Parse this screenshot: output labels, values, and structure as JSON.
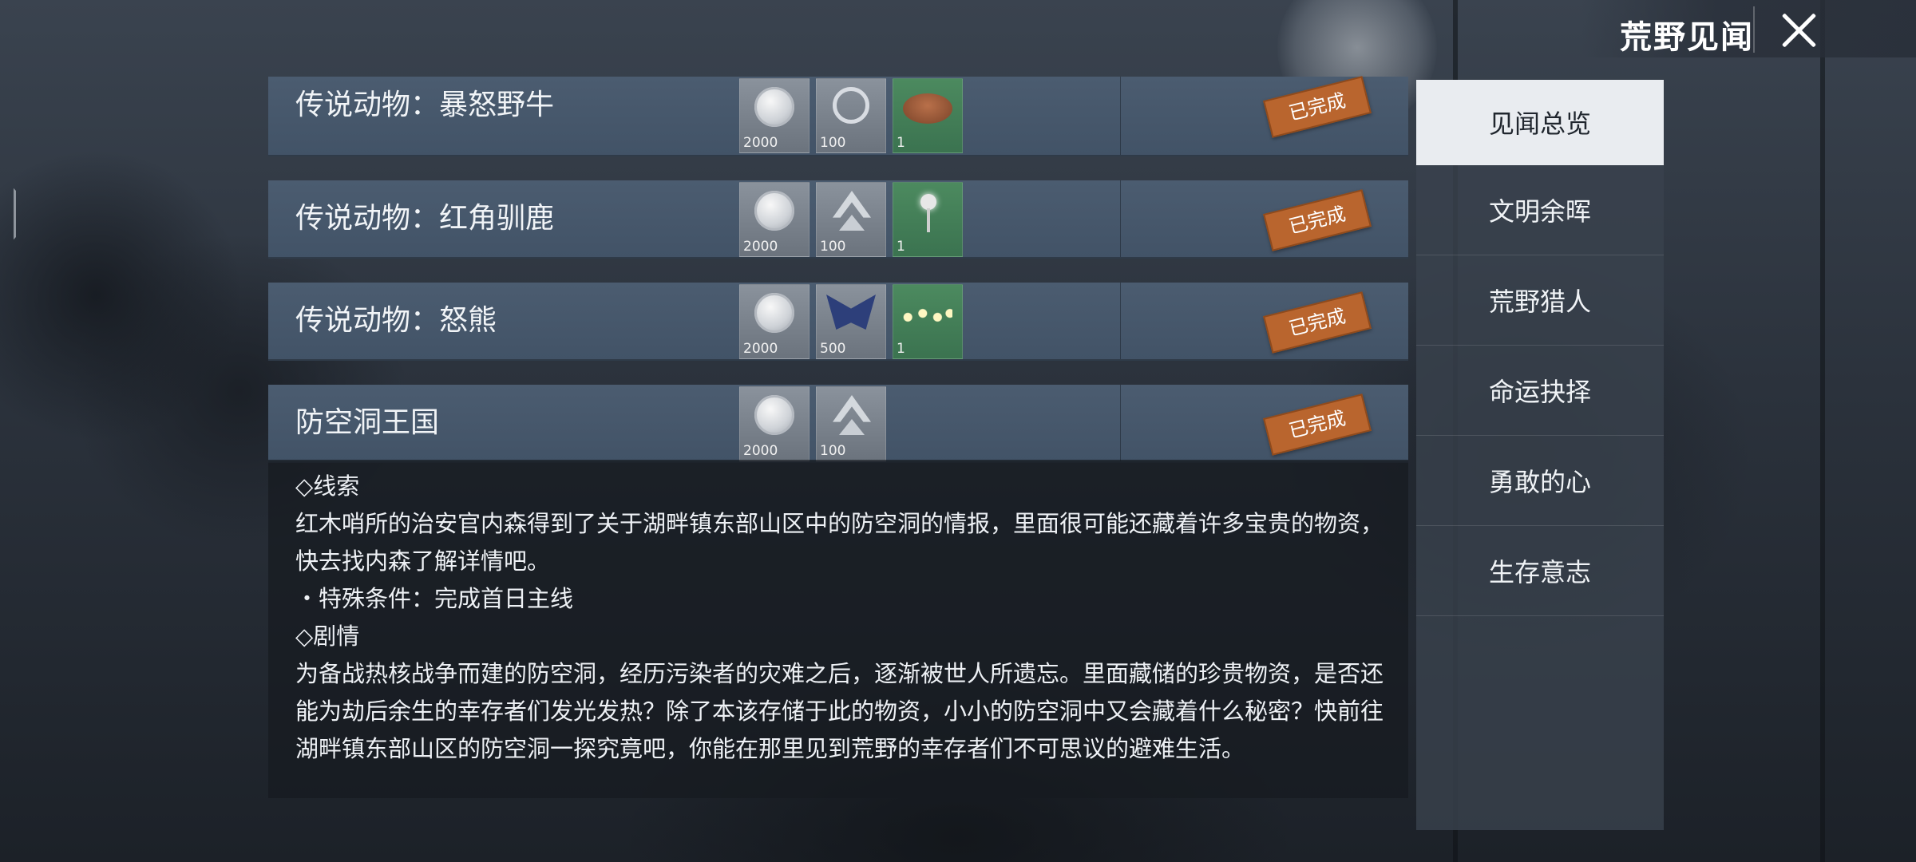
{
  "header": {
    "title": "荒野见闻"
  },
  "rows": [
    {
      "name": "传说动物：暴怒野牛",
      "status": "已完成",
      "rewards": [
        {
          "icon": "silver-coin-icon",
          "count": "2000"
        },
        {
          "icon": "target-badge-icon",
          "count": "100"
        },
        {
          "icon": "bison-trophy-icon",
          "count": "1"
        }
      ]
    },
    {
      "name": "传说动物：红角驯鹿",
      "status": "已完成",
      "rewards": [
        {
          "icon": "silver-coin-icon",
          "count": "2000"
        },
        {
          "icon": "rank-emblem-icon",
          "count": "100"
        },
        {
          "icon": "street-lamp-icon",
          "count": "1"
        }
      ]
    },
    {
      "name": "传说动物：怒熊",
      "status": "已完成",
      "rewards": [
        {
          "icon": "silver-coin-icon",
          "count": "2000"
        },
        {
          "icon": "eagle-emblem-icon",
          "count": "500"
        },
        {
          "icon": "string-lights-icon",
          "count": "1"
        }
      ]
    },
    {
      "name": "防空洞王国",
      "status": "已完成",
      "rewards": [
        {
          "icon": "silver-coin-icon",
          "count": "2000"
        },
        {
          "icon": "rank-emblem-icon",
          "count": "100"
        }
      ]
    }
  ],
  "detail": {
    "clue_heading": "◇线索",
    "clue_text": "红木哨所的治安官内森得到了关于湖畔镇东部山区中的防空洞的情报，里面很可能还藏着许多宝贵的物资，快去找内森了解详情吧。",
    "condition": "・特殊条件：完成首日主线",
    "story_heading": "◇剧情",
    "story_text": "为备战热核战争而建的防空洞，经历污染者的灾难之后，逐渐被世人所遗忘。里面藏储的珍贵物资，是否还能为劫后余生的幸存者们发光发热？除了本该存储于此的物资，小小的防空洞中又会藏着什么秘密？快前往湖畔镇东部山区的防空洞一探究竟吧，你能在那里见到荒野的幸存者们不可思议的避难生活。"
  },
  "tabs": [
    {
      "label": "见闻总览",
      "active": true
    },
    {
      "label": "文明余晖",
      "active": false
    },
    {
      "label": "荒野猎人",
      "active": false
    },
    {
      "label": "命运抉择",
      "active": false
    },
    {
      "label": "勇敢的心",
      "active": false
    },
    {
      "label": "生存意志",
      "active": false
    }
  ],
  "colors": {
    "status_badge": "#b9652e",
    "row_bg": "#4b5c70",
    "active_tab_bg": "#e9ecf0"
  }
}
